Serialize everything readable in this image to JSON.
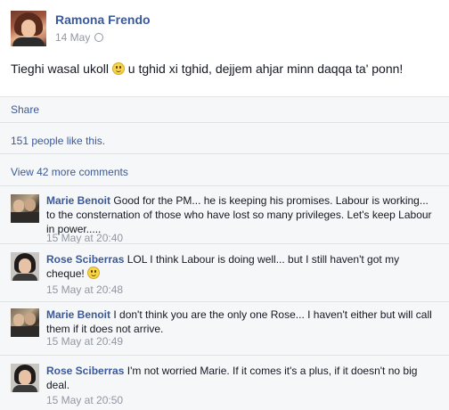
{
  "post": {
    "author": "Ramona Frendo",
    "date": "14 May",
    "privacy_icon": "globe-icon",
    "text_before": "Tieghi wasal ukoll ",
    "text_after": " u tghid xi tghid, dejjem ahjar minn daqqa ta' ponn!"
  },
  "actions": {
    "share": "Share",
    "likes": "151 people like this.",
    "view_more": "View 42 more comments"
  },
  "comments": [
    {
      "author": "Marie Benoit",
      "text": "Good for the PM... he is keeping his promises. Labour is working... to the consternation of those who have lost so many privileges. Let's keep Labour in power.....",
      "time": "15 May at 20:40"
    },
    {
      "author": "Rose Sciberras",
      "text": "LOL I think Labour is doing well... but I still haven't got my cheque!",
      "time": "15 May at 20:48"
    },
    {
      "author": "Marie Benoit",
      "text": "I don't think you are the only one Rose... I haven't either but will call them if it does not arrive.",
      "time": "15 May at 20:49"
    },
    {
      "author": "Rose Sciberras",
      "text": "I'm not worried Marie. If it comes it's a plus, if it doesn't no big deal.",
      "time": "15 May at 20:50"
    }
  ],
  "colors": {
    "link": "#3b5998",
    "meta": "#9197a3",
    "feedback_bg": "#f6f7f8"
  }
}
